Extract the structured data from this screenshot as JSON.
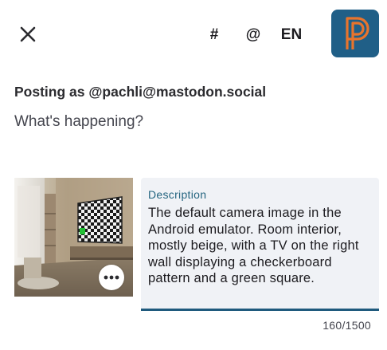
{
  "toolbar": {
    "close_icon": "close-icon",
    "hashtag_label": "#",
    "mention_label": "@",
    "language_label": "EN",
    "account_avatar_letter": "P",
    "colors": {
      "avatar_bg": "#205f87",
      "avatar_letter": "#e8742c"
    }
  },
  "compose": {
    "posting_as": "Posting as @pachli@mastodon.social",
    "placeholder": "What's happening?",
    "value": ""
  },
  "attachment": {
    "more_icon": "more-horizontal-icon",
    "description_label": "Description",
    "description_text": "The default camera image in the Android emulator. Room interior, mostly beige, with a TV on the right wall displaying a checkerboard pattern and a green square.",
    "char_count": "160/1500",
    "colors": {
      "accent": "#1f5a7d",
      "field_bg": "#f0f2f6",
      "label": "#23647f"
    }
  }
}
